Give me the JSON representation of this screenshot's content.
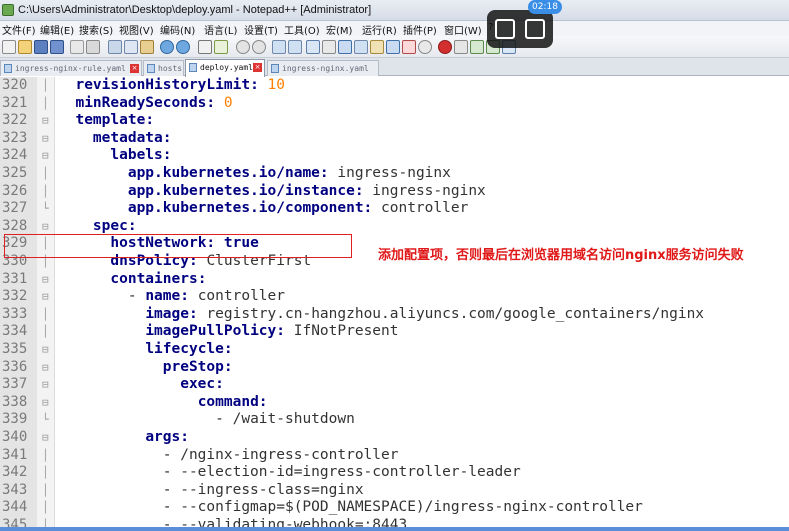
{
  "window": {
    "title": "C:\\Users\\Administrator\\Desktop\\deploy.yaml - Notepad++ [Administrator]"
  },
  "menu": [
    "文件(F)",
    "编辑(E)",
    "搜索(S)",
    "视图(V)",
    "编码(N)",
    "语言(L)",
    "设置(T)",
    "工具(O)",
    "宏(M)",
    "运行(R)",
    "插件(P)",
    "窗口(W)",
    "?"
  ],
  "tabs": [
    {
      "label": "ingress-nginx-rule.yaml",
      "active": false
    },
    {
      "label": "hosts",
      "active": false
    },
    {
      "label": "deploy.yaml",
      "active": true
    },
    {
      "label": "ingress-nginx.yaml",
      "active": false
    }
  ],
  "overlay": {
    "time": "02:18"
  },
  "annotation": {
    "note": "添加配置项，否则最后在浏览器用域名访问nginx服务访问失败"
  },
  "editor": {
    "lines": [
      {
        "num": "320",
        "indent": "  ",
        "key": "revisionHistoryLimit",
        "sep": ": ",
        "value": "10",
        "vtype": "num",
        "fold": "line"
      },
      {
        "num": "321",
        "indent": "  ",
        "key": "minReadySeconds",
        "sep": ": ",
        "value": "0",
        "vtype": "num",
        "fold": "line"
      },
      {
        "num": "322",
        "indent": "  ",
        "key": "template",
        "sep": ":",
        "value": "",
        "vtype": "",
        "fold": "minus"
      },
      {
        "num": "323",
        "indent": "    ",
        "key": "metadata",
        "sep": ":",
        "value": "",
        "vtype": "",
        "fold": "minus"
      },
      {
        "num": "324",
        "indent": "      ",
        "key": "labels",
        "sep": ":",
        "value": "",
        "vtype": "",
        "fold": "minus"
      },
      {
        "num": "325",
        "indent": "        ",
        "key": "app.kubernetes.io/name",
        "sep": ": ",
        "value": "ingress-nginx",
        "vtype": "str",
        "fold": "line"
      },
      {
        "num": "326",
        "indent": "        ",
        "key": "app.kubernetes.io/instance",
        "sep": ": ",
        "value": "ingress-nginx",
        "vtype": "str",
        "fold": "line"
      },
      {
        "num": "327",
        "indent": "        ",
        "key": "app.kubernetes.io/component",
        "sep": ": ",
        "value": "controller",
        "vtype": "str",
        "fold": "end"
      },
      {
        "num": "328",
        "indent": "    ",
        "key": "spec",
        "sep": ":",
        "value": "",
        "vtype": "",
        "fold": "minus"
      },
      {
        "num": "329",
        "indent": "      ",
        "key": "hostNetwork",
        "sep": ": ",
        "value": "true",
        "vtype": "bool",
        "fold": "line"
      },
      {
        "num": "330",
        "indent": "      ",
        "key": "dnsPolicy",
        "sep": ": ",
        "value": "ClusterFirst",
        "vtype": "str",
        "fold": "line"
      },
      {
        "num": "331",
        "indent": "      ",
        "key": "containers",
        "sep": ":",
        "value": "",
        "vtype": "",
        "fold": "minus"
      },
      {
        "num": "332",
        "indent": "        - ",
        "key": "name",
        "sep": ": ",
        "value": "controller",
        "vtype": "str",
        "fold": "minus"
      },
      {
        "num": "333",
        "indent": "          ",
        "key": "image",
        "sep": ": ",
        "value": "registry.cn-hangzhou.aliyuncs.com/google_containers/nginx",
        "vtype": "str",
        "fold": "line"
      },
      {
        "num": "334",
        "indent": "          ",
        "key": "imagePullPolicy",
        "sep": ": ",
        "value": "IfNotPresent",
        "vtype": "str",
        "fold": "line"
      },
      {
        "num": "335",
        "indent": "          ",
        "key": "lifecycle",
        "sep": ":",
        "value": "",
        "vtype": "",
        "fold": "minus"
      },
      {
        "num": "336",
        "indent": "            ",
        "key": "preStop",
        "sep": ":",
        "value": "",
        "vtype": "",
        "fold": "minus"
      },
      {
        "num": "337",
        "indent": "              ",
        "key": "exec",
        "sep": ":",
        "value": "",
        "vtype": "",
        "fold": "minus"
      },
      {
        "num": "338",
        "indent": "                ",
        "key": "command",
        "sep": ":",
        "value": "",
        "vtype": "",
        "fold": "minus"
      },
      {
        "num": "339",
        "indent": "                  - ",
        "key": "",
        "sep": "",
        "value": "/wait-shutdown",
        "vtype": "str",
        "fold": "end"
      },
      {
        "num": "340",
        "indent": "          ",
        "key": "args",
        "sep": ":",
        "value": "",
        "vtype": "",
        "fold": "minus"
      },
      {
        "num": "341",
        "indent": "            - ",
        "key": "",
        "sep": "",
        "value": "/nginx-ingress-controller",
        "vtype": "str",
        "fold": "line"
      },
      {
        "num": "342",
        "indent": "            - ",
        "key": "",
        "sep": "",
        "value": "--election-id=ingress-controller-leader",
        "vtype": "str",
        "fold": "line"
      },
      {
        "num": "343",
        "indent": "            - ",
        "key": "",
        "sep": "",
        "value": "--ingress-class=nginx",
        "vtype": "str",
        "fold": "line"
      },
      {
        "num": "344",
        "indent": "            - ",
        "key": "",
        "sep": "",
        "value": "--configmap=$(POD_NAMESPACE)/ingress-nginx-controller",
        "vtype": "str",
        "fold": "line"
      },
      {
        "num": "345",
        "indent": "            - ",
        "key": "",
        "sep": "",
        "value": "--validating-webhook=:8443",
        "vtype": "str",
        "fold": "line"
      }
    ]
  },
  "colors": {
    "key": "#000080",
    "number": "#ff8000",
    "annotation": "#e01818"
  },
  "icons": [
    "notepad-icon",
    "new-file-icon",
    "open-file-icon",
    "save-icon",
    "save-all-icon",
    "close-icon",
    "print-icon",
    "cut-icon",
    "copy-icon",
    "paste-icon",
    "undo-icon",
    "redo-icon",
    "find-icon",
    "replace-icon",
    "zoom-in-icon",
    "zoom-out-icon",
    "record-macro-icon",
    "play-macro-icon",
    "pip-icon",
    "capture-icon"
  ]
}
